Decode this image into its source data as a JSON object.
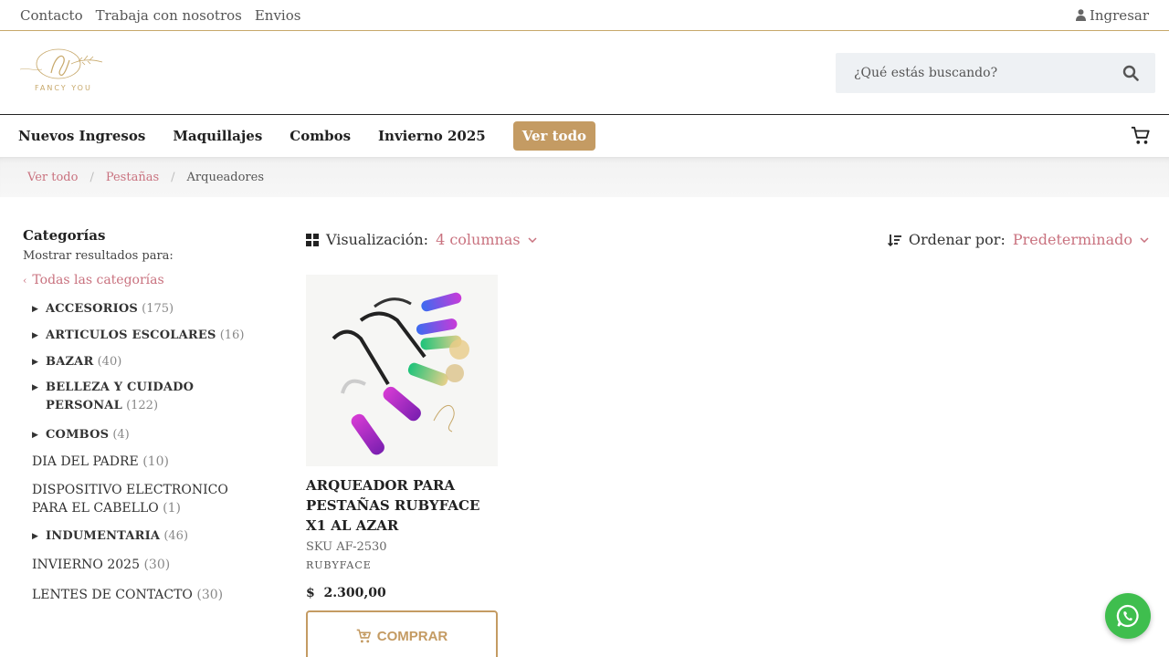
{
  "topbar": {
    "links": [
      "Contacto",
      "Trabaja con nosotros",
      "Envios"
    ],
    "login": "Ingresar"
  },
  "header": {
    "logo_text": "FANCY YOU",
    "search_placeholder": "¿Qué estás buscando?"
  },
  "nav": {
    "items": [
      "Nuevos Ingresos",
      "Maquillajes",
      "Combos",
      "Invierno 2025"
    ],
    "active": "Ver todo"
  },
  "breadcrumb": [
    "Ver todo",
    "Pestañas",
    "Arqueadores"
  ],
  "sidebar": {
    "title": "Categorías",
    "subtitle": "Mostrar resultados para:",
    "all_link": "Todas las categorías",
    "categories": [
      {
        "name": "ACCESORIOS",
        "count": "(175)"
      },
      {
        "name": "ARTICULOS ESCOLARES",
        "count": "(16)"
      },
      {
        "name": "BAZAR",
        "count": "(40)"
      },
      {
        "name": "BELLEZA Y CUIDADO PERSONAL",
        "count": "(122)"
      },
      {
        "name": "COMBOS",
        "count": "(4)"
      },
      {
        "name": "DIA DEL PADRE",
        "count": "(10)"
      },
      {
        "name": "DISPOSITIVO ELECTRONICO PARA EL CABELLO",
        "count": "(1)"
      },
      {
        "name": "INDUMENTARIA",
        "count": "(46)"
      },
      {
        "name": "INVIERNO 2025",
        "count": "(30)"
      },
      {
        "name": "LENTES DE CONTACTO",
        "count": "(30)"
      }
    ]
  },
  "toolbar": {
    "view_label": "Visualización:",
    "view_value": "4 columnas",
    "sort_label": "Ordenar por:",
    "sort_value": "Predeterminado"
  },
  "product": {
    "title": "ARQUEADOR PARA PESTAÑAS RUBYFACE X1 AL AZAR",
    "sku": "SKU AF-2530",
    "brand": "RUBYFACE",
    "price": "$  2.300,00",
    "button": "COMPRAR"
  },
  "colors": {
    "accent": "#c49b63",
    "link": "#c9727f",
    "whatsapp": "#3fbe4e"
  }
}
